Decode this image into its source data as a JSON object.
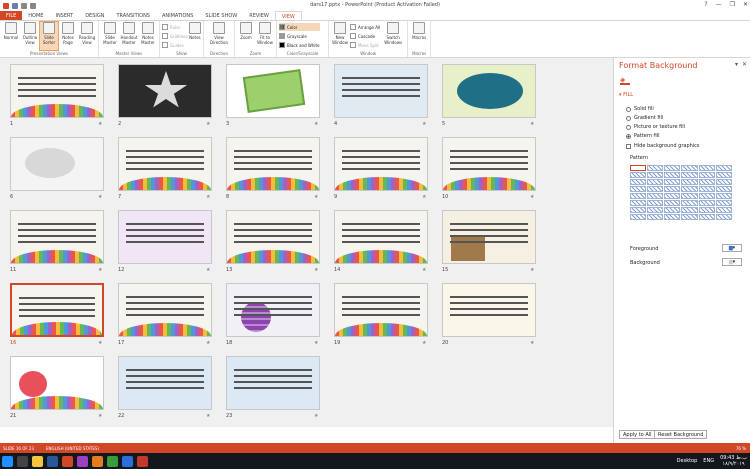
{
  "window": {
    "title": "dars17.pptx - PowerPoint (Product Activation Failed)",
    "controls": [
      "?",
      "—",
      "❐",
      "✕"
    ]
  },
  "tabs": [
    {
      "label": "FILE"
    },
    {
      "label": "HOME"
    },
    {
      "label": "INSERT"
    },
    {
      "label": "DESIGN"
    },
    {
      "label": "TRANSITIONS"
    },
    {
      "label": "ANIMATIONS"
    },
    {
      "label": "SLIDE SHOW"
    },
    {
      "label": "REVIEW"
    },
    {
      "label": "VIEW"
    }
  ],
  "ribbon": {
    "presentation_views": {
      "label": "Presentation Views",
      "buttons": [
        "Normal",
        "Outline View",
        "Slide Sorter",
        "Notes Page",
        "Reading View"
      ]
    },
    "master_views": {
      "label": "Master Views",
      "buttons": [
        "Slide Master",
        "Handout Master",
        "Notes Master"
      ]
    },
    "show": {
      "label": "Show",
      "items": [
        "Ruler",
        "Gridlines",
        "Guides"
      ]
    },
    "notes_btn": "Notes",
    "direction": {
      "label": "Direction",
      "button": "View Direction"
    },
    "zoom": {
      "label": "Zoom",
      "buttons": [
        "Zoom",
        "Fit to Window"
      ]
    },
    "color": {
      "label": "Color/Grayscale",
      "items": [
        "Color",
        "Grayscale",
        "Black and White"
      ]
    },
    "window": {
      "label": "Window",
      "new_window": "New Window",
      "items": [
        "Arrange All",
        "Cascade",
        "Move Split"
      ],
      "switch": "Switch Windows"
    },
    "macros": {
      "label": "Macros",
      "button": "Macros"
    }
  },
  "slides": [
    {
      "n": "1"
    },
    {
      "n": "2"
    },
    {
      "n": "3"
    },
    {
      "n": "4"
    },
    {
      "n": "5"
    },
    {
      "n": "6"
    },
    {
      "n": "7"
    },
    {
      "n": "8"
    },
    {
      "n": "9"
    },
    {
      "n": "10"
    },
    {
      "n": "11"
    },
    {
      "n": "12"
    },
    {
      "n": "13"
    },
    {
      "n": "14"
    },
    {
      "n": "15"
    },
    {
      "n": "16"
    },
    {
      "n": "17"
    },
    {
      "n": "18"
    },
    {
      "n": "19"
    },
    {
      "n": "20"
    },
    {
      "n": "21"
    },
    {
      "n": "22"
    },
    {
      "n": "23"
    }
  ],
  "format_panel": {
    "title": "Format Background",
    "section": "FILL",
    "fill_options": [
      "Solid fill",
      "Gradient fill",
      "Picture or texture fill",
      "Pattern fill"
    ],
    "hide_graphics": "Hide background graphics",
    "pattern_label": "Pattern",
    "foreground_label": "Foreground",
    "background_label": "Background",
    "apply_all": "Apply to All",
    "reset": "Reset Background"
  },
  "status": {
    "slide": "SLIDE 16 OF 23",
    "language": "ENGLISH (UNITED STATES)",
    "zoom": "76 %"
  },
  "taskbar": {
    "desktop": "Desktop",
    "lang": "ENG",
    "time": "09:43 ب.ظ",
    "date": "۱۸/۹/۲۰۱۹"
  },
  "colors": {
    "accent": "#d24726",
    "taskbar": "#13181d"
  }
}
